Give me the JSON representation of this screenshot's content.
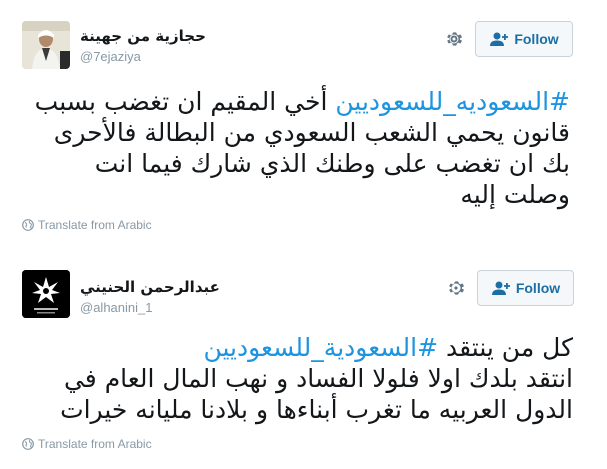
{
  "tweets": [
    {
      "display_name": "حجازية من جهينة",
      "handle": "@7ejaziya",
      "follow_label": "Follow",
      "text_lines": [
        {
          "hashtag": "#السعوديه_للسعوديين",
          "rest": " أخي المقيم ان تغضب بسبب"
        },
        {
          "hashtag": "",
          "rest": "قانون يحمي الشعب السعودي من البطالة فالأحرى"
        },
        {
          "hashtag": "",
          "rest": "بك ان تغضب على وطنك الذي شارك فيما انت"
        },
        {
          "hashtag": "",
          "rest": "وصلت إليه"
        }
      ],
      "translate_label": "Translate from Arabic"
    },
    {
      "display_name": "عبدالرحمن الحنيني",
      "handle": "@alhanini_1",
      "follow_label": "Follow",
      "text_lines": [
        {
          "hashtag": "#السعودية_للسعوديين",
          "rest": "كل من ينتقد "
        },
        {
          "hashtag": "",
          "rest": "انتقد بلدك اولا فلولا الفساد و نهب المال العام في"
        },
        {
          "hashtag": "",
          "rest": "الدول العربيه ما تغرب أبناءها و بلادنا مليانه خيرات"
        }
      ],
      "translate_label": "Translate from Arabic"
    }
  ],
  "icons": {
    "gear": "gear-icon",
    "follow": "user-plus-icon",
    "globe": "globe-icon"
  },
  "colors": {
    "hashtag": "#1c94e0",
    "follow_text": "#1c6ea4",
    "muted": "#8899a6"
  }
}
